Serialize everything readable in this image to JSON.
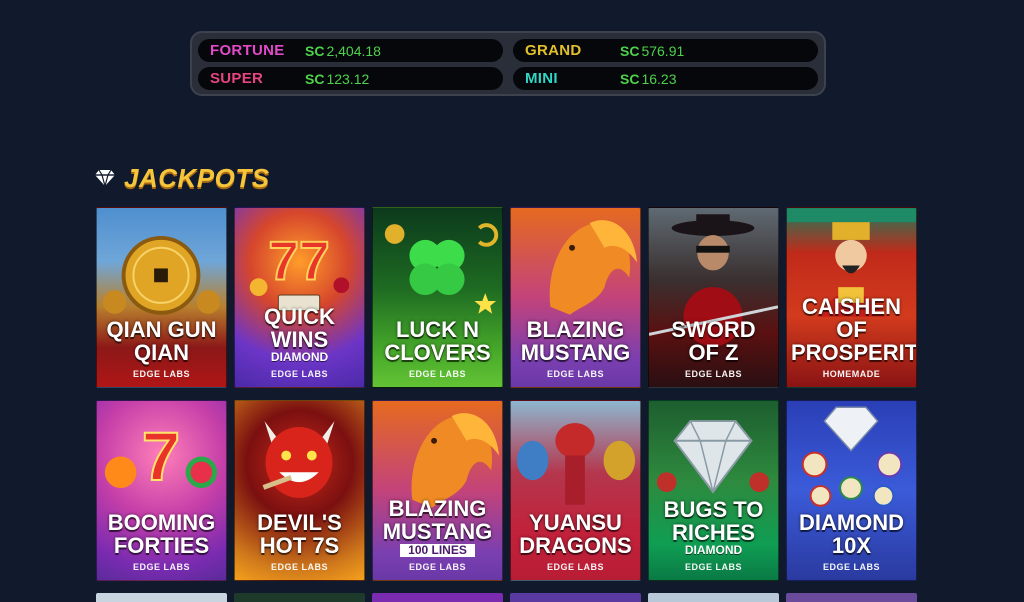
{
  "ticker": [
    {
      "label": "FORTUNE",
      "currency": "SC",
      "amount": "2,404.18",
      "color": "#e24ac9"
    },
    {
      "label": "GRAND",
      "currency": "SC",
      "amount": "576.91",
      "color": "#e3c02b"
    },
    {
      "label": "SUPER",
      "currency": "SC",
      "amount": "123.12",
      "color": "#e8457c"
    },
    {
      "label": "MINI",
      "currency": "SC",
      "amount": "16.23",
      "color": "#2fd7c4"
    }
  ],
  "section": {
    "icon": "diamond-icon",
    "title": "JACKPOTS"
  },
  "games": [
    {
      "name": "QIAN GUN\nQIAN",
      "sub": "",
      "studio": "EDGE LABS",
      "theme": "t-qian"
    },
    {
      "name": "QUICK\nWINS",
      "sub": "DIAMOND",
      "studio": "EDGE LABS",
      "theme": "t-quick"
    },
    {
      "name": "LUCK N\nCLOVERS",
      "sub": "",
      "studio": "EDGE LABS",
      "theme": "t-luck"
    },
    {
      "name": "BLAZING\nMUSTANG",
      "sub": "",
      "studio": "EDGE LABS",
      "theme": "t-blazing"
    },
    {
      "name": "SWORD\nOF Z",
      "sub": "",
      "studio": "EDGE LABS",
      "theme": "t-sword"
    },
    {
      "name": "CAISHEN OF\nPROSPERITY",
      "sub": "",
      "studio": "HOMEMADE",
      "theme": "t-caishen"
    },
    {
      "name": "BOOMING\nFORTIES",
      "sub": "",
      "studio": "EDGE LABS",
      "theme": "t-booming"
    },
    {
      "name": "DEVIL'S\nHOT 7S",
      "sub": "",
      "studio": "EDGE LABS",
      "theme": "t-devil"
    },
    {
      "name": "BLAZING\nMUSTANG",
      "sub": "100 LINES",
      "studio": "EDGE LABS",
      "theme": "t-blazing2"
    },
    {
      "name": "YUANSU\nDRAGONS",
      "sub": "",
      "studio": "EDGE LABS",
      "theme": "t-yuansu"
    },
    {
      "name": "BUGS TO\nRICHES",
      "sub": "DIAMOND",
      "studio": "EDGE LABS",
      "theme": "t-bugs"
    },
    {
      "name": "DIAMOND\n10X",
      "sub": "",
      "studio": "EDGE LABS",
      "theme": "t-diamond"
    }
  ]
}
